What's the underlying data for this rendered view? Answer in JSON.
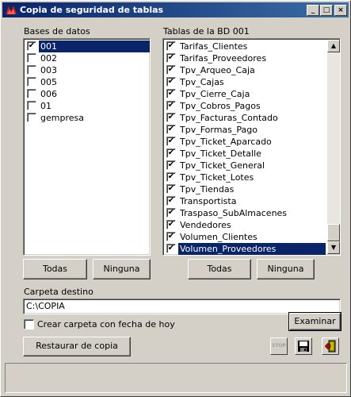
{
  "window": {
    "title": "Copia de seguridad de tablas",
    "minimize_glyph": "_",
    "maximize_glyph": "□",
    "close_glyph": "×"
  },
  "databases": {
    "label": "Bases de datos",
    "items": [
      {
        "label": "001",
        "checked": true,
        "selected": true
      },
      {
        "label": "002",
        "checked": false
      },
      {
        "label": "003",
        "checked": false
      },
      {
        "label": "005",
        "checked": false
      },
      {
        "label": "006",
        "checked": false
      },
      {
        "label": "01",
        "checked": false
      },
      {
        "label": "gempresa",
        "checked": false
      }
    ],
    "all_button": "Todas",
    "none_button": "Ninguna"
  },
  "tables": {
    "label": "Tablas de la BD 001",
    "items": [
      {
        "label": "Tarifas_Clientes",
        "checked": true
      },
      {
        "label": "Tarifas_Proveedores",
        "checked": true
      },
      {
        "label": "Tpv_Arqueo_Caja",
        "checked": true
      },
      {
        "label": "Tpv_Cajas",
        "checked": true
      },
      {
        "label": "Tpv_Cierre_Caja",
        "checked": true
      },
      {
        "label": "Tpv_Cobros_Pagos",
        "checked": true
      },
      {
        "label": "Tpv_Facturas_Contado",
        "checked": true
      },
      {
        "label": "Tpv_Formas_Pago",
        "checked": true
      },
      {
        "label": "Tpv_Ticket_Aparcado",
        "checked": true
      },
      {
        "label": "Tpv_Ticket_Detalle",
        "checked": true
      },
      {
        "label": "Tpv_Ticket_General",
        "checked": true
      },
      {
        "label": "Tpv_Ticket_Lotes",
        "checked": true
      },
      {
        "label": "Tpv_Tiendas",
        "checked": true
      },
      {
        "label": "Transportista",
        "checked": true
      },
      {
        "label": "Traspaso_SubAlmacenes",
        "checked": true
      },
      {
        "label": "Vendedores",
        "checked": true
      },
      {
        "label": "Volumen_Clientes",
        "checked": true
      },
      {
        "label": "Volumen_Proveedores",
        "checked": true,
        "selected": true
      }
    ],
    "all_button": "Todas",
    "none_button": "Ninguna"
  },
  "destination": {
    "label": "Carpeta destino",
    "value": "C:\\COPIA",
    "browse_button": "Examinar"
  },
  "options": {
    "create_dated_folder_label": "Crear carpeta con fecha de hoy",
    "create_dated_folder_checked": false
  },
  "actions": {
    "restore_button": "Restaurar de copia",
    "stop_label": "STOP"
  },
  "colors": {
    "titlebar_start": "#0a246a",
    "titlebar_end": "#3a6ea5",
    "selection": "#0a246a",
    "face": "#d4d0c8"
  }
}
